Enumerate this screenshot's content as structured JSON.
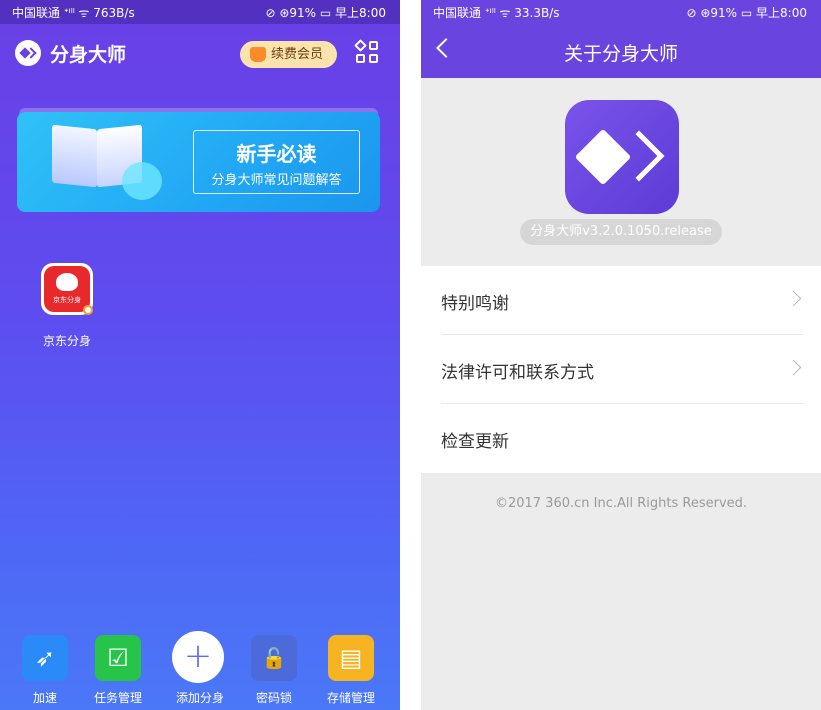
{
  "left_screen": {
    "status_bar": {
      "left": "中国联通 ᐩᴵˡˡ ᯤ 763B/s",
      "right": "⊘ ⊛91% ▭ 早上8:00"
    },
    "app_title": "分身大师",
    "vip_button": "续费会员",
    "banner": {
      "title": "新手必读",
      "subtitle": "分身大师常见问题解答"
    },
    "apps": [
      {
        "name": "京东分身",
        "icon_text": "京东分身"
      }
    ],
    "dock": [
      {
        "label": "加速",
        "icon": "rocket-icon",
        "glyph": "➶",
        "color": "#2a8bf8"
      },
      {
        "label": "任务管理",
        "icon": "checklist-icon",
        "glyph": "☑",
        "color": "#28c44a"
      },
      {
        "label": "添加分身",
        "icon": "plus-icon",
        "glyph": "+",
        "color": "#ffffff"
      },
      {
        "label": "密码锁",
        "icon": "lock-icon",
        "glyph": "🔓",
        "color": "#4c6ad9"
      },
      {
        "label": "存储管理",
        "icon": "sd-card-icon",
        "glyph": "▤",
        "color": "#f7b422"
      }
    ]
  },
  "right_screen": {
    "status_bar": {
      "left": "中国联通 ᐩᴵˡˡ ᯤ 33.3B/s",
      "right": "⊘ ⊛91% ▭ 早上8:00"
    },
    "title": "关于分身大师",
    "version": "分身大师v3.2.0.1050.release",
    "menu": [
      {
        "label": "特别鸣谢",
        "has_arrow": true
      },
      {
        "label": "法律许可和联系方式",
        "has_arrow": true
      },
      {
        "label": "检查更新",
        "has_arrow": false
      }
    ],
    "copyright": "©2017 360.cn Inc.All Rights Reserved."
  },
  "colors": {
    "primary": "#6a44df",
    "accent_gradient_end": "#4a78f7",
    "vip": "#fbe3ad"
  }
}
